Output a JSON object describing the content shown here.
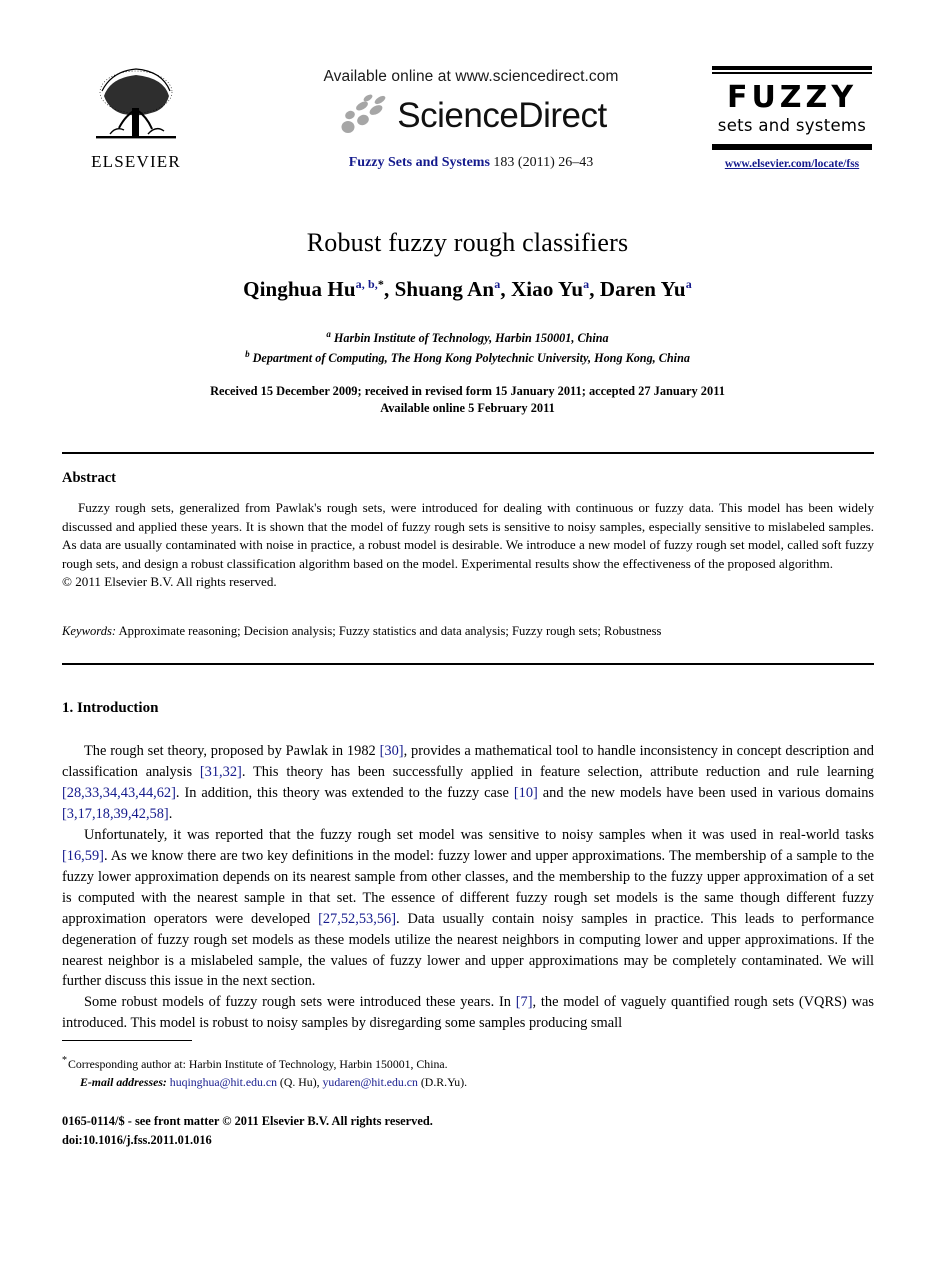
{
  "masthead": {
    "publisher_name": "ELSEVIER",
    "available_online": "Available online at www.sciencedirect.com",
    "sciencedirect_wordmark": "ScienceDirect",
    "journal_name": "Fuzzy Sets and Systems",
    "journal_volume_line": "183 (2011) 26–43",
    "logo_title": "FUZZY",
    "logo_subtitle": "sets and systems",
    "journal_url": "www.elsevier.com/locate/fss"
  },
  "title_block": {
    "title": "Robust fuzzy rough classifiers",
    "authors": [
      {
        "name": "Qinghua Hu",
        "sup": "a, b,",
        "star": "*",
        "sep": ", "
      },
      {
        "name": "Shuang An",
        "sup": "a",
        "star": "",
        "sep": ", "
      },
      {
        "name": "Xiao Yu",
        "sup": "a",
        "star": "",
        "sep": ", "
      },
      {
        "name": "Daren Yu",
        "sup": "a",
        "star": "",
        "sep": ""
      }
    ],
    "affiliations": [
      {
        "marker": "a",
        "text": "Harbin Institute of Technology, Harbin 150001, China"
      },
      {
        "marker": "b",
        "text": "Department of Computing, The Hong Kong Polytechnic University, Hong Kong, China"
      }
    ],
    "received_line": "Received 15 December 2009; received in revised form 15 January 2011; accepted 27 January 2011",
    "available_line": "Available online 5 February 2011"
  },
  "abstract": {
    "heading": "Abstract",
    "body": "Fuzzy rough sets, generalized from Pawlak's rough sets, were introduced for dealing with continuous or fuzzy data. This model has been widely discussed and applied these years. It is shown that the model of fuzzy rough sets is sensitive to noisy samples, especially sensitive to mislabeled samples. As data are usually contaminated with noise in practice, a robust model is desirable. We introduce a new model of fuzzy rough set model, called soft fuzzy rough sets, and design a robust classification algorithm based on the model. Experimental results show the effectiveness of the proposed algorithm.",
    "copyright": "© 2011 Elsevier B.V. All rights reserved."
  },
  "keywords": {
    "label": "Keywords:",
    "list": "Approximate reasoning; Decision analysis; Fuzzy statistics and data analysis; Fuzzy rough sets; Robustness"
  },
  "section": {
    "heading": "1.  Introduction",
    "paragraphs": [
      {
        "parts": [
          {
            "t": "The rough set theory, proposed by Pawlak in 1982 "
          },
          {
            "t": "[30]",
            "cite": true
          },
          {
            "t": ", provides a mathematical tool to handle inconsistency in concept description and classification analysis "
          },
          {
            "t": "[31,32]",
            "cite": true
          },
          {
            "t": ". This theory has been successfully applied in feature selection, attribute reduction and rule learning "
          },
          {
            "t": "[28,33,34,43,44,62]",
            "cite": true
          },
          {
            "t": ". In addition, this theory was extended to the fuzzy case "
          },
          {
            "t": "[10]",
            "cite": true
          },
          {
            "t": " and the new models have been used in various domains "
          },
          {
            "t": "[3,17,18,39,42,58]",
            "cite": true
          },
          {
            "t": "."
          }
        ]
      },
      {
        "parts": [
          {
            "t": "Unfortunately, it was reported that the fuzzy rough set model was sensitive to noisy samples when it was used in real-world tasks "
          },
          {
            "t": "[16,59]",
            "cite": true
          },
          {
            "t": ". As we know there are two key definitions in the model: fuzzy lower and upper approximations. The membership of a sample to the fuzzy lower approximation depends on its nearest sample from other classes, and the membership to the fuzzy upper approximation of a set is computed with the nearest sample in that set. The essence of different fuzzy rough set models is the same though different fuzzy approximation operators were developed "
          },
          {
            "t": "[27,52,53,56]",
            "cite": true
          },
          {
            "t": ". Data usually contain noisy samples in practice. This leads to performance degeneration of fuzzy rough set models as these models utilize the nearest neighbors in computing lower and upper approximations. If the nearest neighbor is a mislabeled sample, the values of fuzzy lower and upper approximations may be completely contaminated. We will further discuss this issue in the next section."
          }
        ]
      },
      {
        "parts": [
          {
            "t": "Some robust models of fuzzy rough sets were introduced these years. In "
          },
          {
            "t": "[7]",
            "cite": true
          },
          {
            "t": ", the model of vaguely quantified rough sets (VQRS) was introduced. This model is robust to noisy samples by disregarding some samples producing small"
          }
        ]
      }
    ]
  },
  "footnote": {
    "star": "*",
    "corresponding": "Corresponding author at: Harbin Institute of Technology, Harbin 150001, China.",
    "email_label": "E-mail addresses:",
    "emails": [
      {
        "address": "huqinghua@hit.edu.cn",
        "owner": "(Q. Hu)",
        "sep": ", "
      },
      {
        "address": "yudaren@hit.edu.cn",
        "owner": "(D.R.Yu).",
        "sep": ""
      }
    ]
  },
  "imprint": {
    "issn_line": "0165-0114/$ - see front matter © 2011 Elsevier B.V. All rights reserved.",
    "doi_line": "doi:10.1016/j.fss.2011.01.016"
  },
  "colors": {
    "link_blue": "#151b8d",
    "text_black": "#000000",
    "page_background": "#ffffff"
  }
}
